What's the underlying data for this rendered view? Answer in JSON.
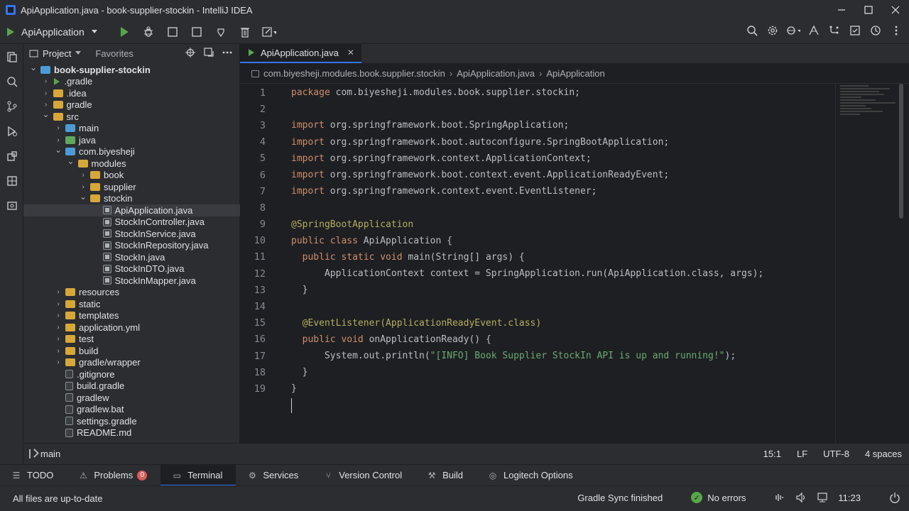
{
  "window": {
    "title": "ApiApplication.java - book-supplier-stockin - IntelliJ IDEA"
  },
  "toolbar": {
    "run_config": "ApiApplication"
  },
  "project_panel": {
    "tab_label": "Project",
    "favorites_label": "Favorites",
    "tree": [
      {
        "name": "book-supplier-stockin",
        "depth": 0,
        "expanded": true,
        "icon": "module-folder",
        "bold": true
      },
      {
        "name": ".gradle",
        "depth": 1,
        "expanded": false,
        "icon": "gradle"
      },
      {
        "name": ".idea",
        "depth": 1,
        "expanded": false,
        "icon": "folder"
      },
      {
        "name": "gradle",
        "depth": 1,
        "expanded": false,
        "icon": "folder"
      },
      {
        "name": "src",
        "depth": 1,
        "expanded": true,
        "icon": "folder"
      },
      {
        "name": "main",
        "depth": 2,
        "expanded": false,
        "icon": "source-folder"
      },
      {
        "name": "java",
        "depth": 2,
        "expanded": false,
        "icon": "test-folder"
      },
      {
        "name": "com.biyesheji",
        "depth": 2,
        "expanded": true,
        "icon": "source-folder"
      },
      {
        "name": "modules",
        "depth": 3,
        "expanded": true,
        "icon": "folder"
      },
      {
        "name": "book",
        "depth": 4,
        "expanded": false,
        "icon": "folder"
      },
      {
        "name": "supplier",
        "depth": 4,
        "expanded": false,
        "icon": "folder"
      },
      {
        "name": "stockin",
        "depth": 4,
        "expanded": true,
        "icon": "folder"
      },
      {
        "name": "ApiApplication.java",
        "depth": 5,
        "icon": "java-file",
        "selected": true
      },
      {
        "name": "StockInController.java",
        "depth": 5,
        "icon": "java-file"
      },
      {
        "name": "StockInService.java",
        "depth": 5,
        "icon": "java-file"
      },
      {
        "name": "StockInRepository.java",
        "depth": 5,
        "icon": "java-file"
      },
      {
        "name": "StockIn.java",
        "depth": 5,
        "icon": "java-file"
      },
      {
        "name": "StockInDTO.java",
        "depth": 5,
        "icon": "java-file"
      },
      {
        "name": "StockInMapper.java",
        "depth": 5,
        "icon": "java-file"
      },
      {
        "name": "resources",
        "depth": 2,
        "expanded": false,
        "icon": "folder"
      },
      {
        "name": "static",
        "depth": 2,
        "expanded": false,
        "icon": "folder"
      },
      {
        "name": "templates",
        "depth": 2,
        "expanded": false,
        "icon": "folder"
      },
      {
        "name": "application.yml",
        "depth": 2,
        "expanded": false,
        "icon": "folder"
      },
      {
        "name": "test",
        "depth": 2,
        "expanded": false,
        "icon": "folder"
      },
      {
        "name": "build",
        "depth": 2,
        "expanded": false,
        "icon": "folder"
      },
      {
        "name": "gradle/wrapper",
        "depth": 2,
        "expanded": false,
        "icon": "folder"
      },
      {
        "name": ".gitignore",
        "depth": 2,
        "icon": "file"
      },
      {
        "name": "build.gradle",
        "depth": 2,
        "icon": "file"
      },
      {
        "name": "gradlew",
        "depth": 2,
        "icon": "file"
      },
      {
        "name": "gradlew.bat",
        "depth": 2,
        "icon": "file"
      },
      {
        "name": "settings.gradle",
        "depth": 2,
        "icon": "file"
      },
      {
        "name": "README.md",
        "depth": 2,
        "icon": "file"
      }
    ]
  },
  "editor": {
    "tab_label": "ApiApplication.java",
    "breadcrumbs": [
      "com.biyesheji.modules.book.supplier.stockin",
      "ApiApplication.java",
      "ApiApplication"
    ],
    "lines": [
      {
        "n": "1",
        "tokens": [
          [
            "kw",
            "package "
          ],
          [
            "pkg",
            "com.biyesheji.modules.book.supplier.stockin;"
          ]
        ]
      },
      {
        "n": "2",
        "tokens": []
      },
      {
        "n": "3",
        "tokens": [
          [
            "kw",
            "import "
          ],
          [
            "pkg",
            "org.springframework.boot.SpringApplication;"
          ]
        ]
      },
      {
        "n": "4",
        "tokens": [
          [
            "kw",
            "import "
          ],
          [
            "pkg",
            "org.springframework.boot.autoconfigure.SpringBootApplication;"
          ]
        ]
      },
      {
        "n": "5",
        "tokens": [
          [
            "kw",
            "import "
          ],
          [
            "pkg",
            "org.springframework.context.ApplicationContext;"
          ]
        ]
      },
      {
        "n": "6",
        "tokens": [
          [
            "kw",
            "import "
          ],
          [
            "pkg",
            "org.springframework.boot.context.event.ApplicationReadyEvent;"
          ]
        ]
      },
      {
        "n": "7",
        "tokens": [
          [
            "kw",
            "import "
          ],
          [
            "pkg",
            "org.springframework.context.event.EventListener;"
          ]
        ]
      },
      {
        "n": "8",
        "tokens": []
      },
      {
        "n": "9",
        "tokens": [
          [
            "ann",
            "@SpringBootApplication"
          ]
        ]
      },
      {
        "n": "10",
        "tokens": [
          [
            "kw",
            "public class "
          ],
          [
            "pkg",
            "ApiApplication {"
          ]
        ]
      },
      {
        "n": "11",
        "tokens": [
          [
            "pkg",
            "  "
          ],
          [
            "kw",
            "public static void "
          ],
          [
            "pkg",
            "main(String[] args) {"
          ]
        ]
      },
      {
        "n": "12",
        "tokens": [
          [
            "pkg",
            "      ApplicationContext context = SpringApplication.run(ApiApplication.class, args);"
          ]
        ]
      },
      {
        "n": "13",
        "tokens": [
          [
            "pkg",
            "  }"
          ]
        ]
      },
      {
        "n": "14",
        "tokens": []
      },
      {
        "n": "15",
        "tokens": [
          [
            "pkg",
            "  "
          ],
          [
            "ann",
            "@EventListener(ApplicationReadyEvent.class)"
          ]
        ]
      },
      {
        "n": "16",
        "tokens": [
          [
            "pkg",
            "  "
          ],
          [
            "kw",
            "public void "
          ],
          [
            "pkg",
            "onApplicationReady() {"
          ]
        ]
      },
      {
        "n": "17",
        "tokens": [
          [
            "pkg",
            "      System.out.println("
          ],
          [
            "str",
            "\"[INFO] Book Supplier StockIn API is up and running!\""
          ],
          [
            "pkg",
            ");"
          ]
        ]
      },
      {
        "n": "18",
        "tokens": [
          [
            "pkg",
            "  }"
          ]
        ]
      },
      {
        "n": "19",
        "tokens": [
          [
            "pkg",
            "}"
          ]
        ]
      }
    ]
  },
  "status_line": {
    "branch": "main",
    "position": "15:1",
    "line_separator": "LF",
    "encoding": "UTF-8",
    "indent": "4 spaces"
  },
  "tool_tabs": [
    {
      "label": "TODO",
      "icon": "list-icon"
    },
    {
      "label": "Problems",
      "icon": "problems-icon",
      "badge": "0"
    },
    {
      "label": "Terminal",
      "icon": "terminal-icon",
      "active": true
    },
    {
      "label": "Services",
      "icon": "services-icon"
    },
    {
      "label": "Version Control",
      "icon": "vcs-icon"
    },
    {
      "label": "Build",
      "icon": "build-icon"
    },
    {
      "label": "Logitech Options",
      "icon": "logitech-icon"
    }
  ],
  "status_bar": {
    "message": "All files are up-to-date",
    "sync": "Gradle Sync finished",
    "errors": "No errors",
    "time": "11:23"
  },
  "colors": {
    "accent": "#3574f0",
    "run_green": "#57a64a",
    "keyword": "#cf8e6d",
    "annotation": "#b3ae60",
    "string": "#6aab73"
  }
}
